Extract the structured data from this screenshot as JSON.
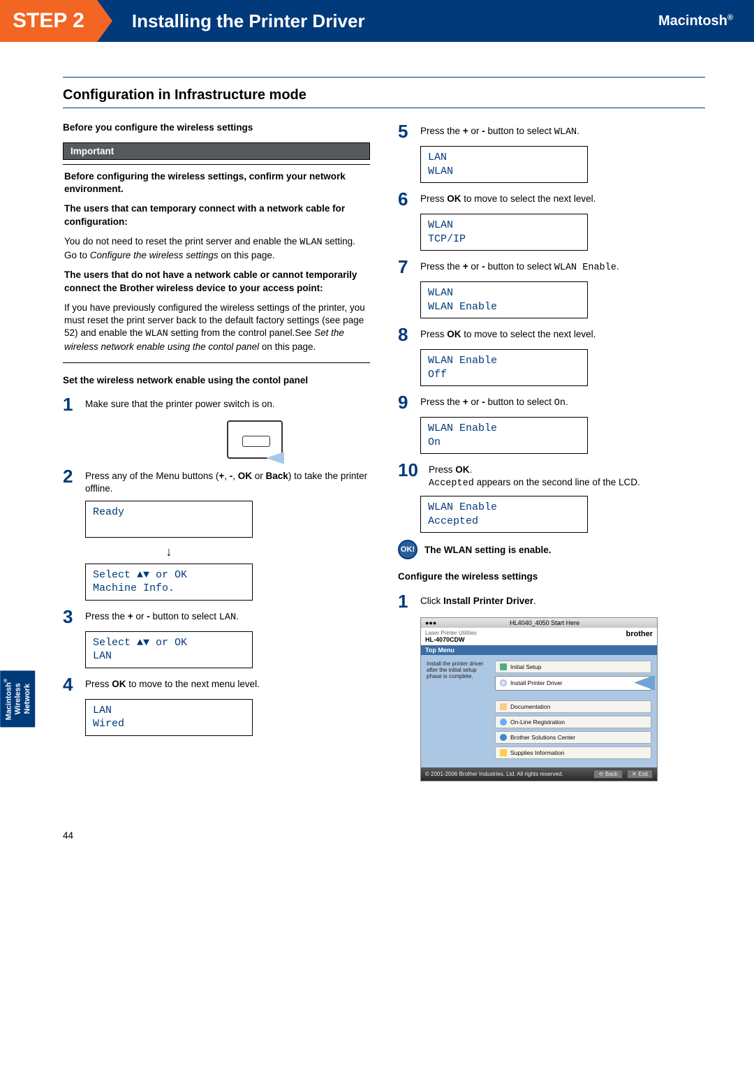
{
  "header": {
    "step_label": "STEP 2",
    "title": "Installing the Printer Driver",
    "platform": "Macintosh",
    "platform_sup": "®"
  },
  "section_title": "Configuration in Infrastructure mode",
  "left": {
    "before_head": "Before you configure the wireless settings",
    "important_label": "Important",
    "imp_p1": "Before configuring the wireless settings, confirm your  network environment.",
    "imp_p2": "The users that can temporary connect with a network cable for configuration:",
    "imp_p3a": "You do not need to reset the print server and enable the ",
    "imp_p3b": "WLAN",
    "imp_p3c": "  setting. Go to ",
    "imp_p3d": "Configure the wireless settings",
    "imp_p3e": " on this page.",
    "imp_p4": "The users that do not have a network cable or cannot temporarily connect the Brother wireless device to your access point:",
    "imp_p5a": "If you have previously configured the wireless settings of the printer, you must reset the print server back to the default factory settings (see page 52) and enable the ",
    "imp_p5b": "WLAN",
    "imp_p5c": " setting from the control panel.See ",
    "imp_p5d": "Set the wireless network enable using the contol panel",
    "imp_p5e": " on this page.",
    "set_head": "Set the wireless network enable using the contol panel",
    "s1_text": "Make sure that the printer power switch is on.",
    "s2_a": "Press any of the Menu buttons (",
    "s2_b": "+",
    "s2_c": ", ",
    "s2_d": "-",
    "s2_e": ", ",
    "s2_f": "OK",
    "s2_g": " or ",
    "s2_h": "Back",
    "s2_i": ") to take the printer offline.",
    "lcd_ready": "Ready",
    "lcd_select1_l1": "Select ▲▼ or OK",
    "lcd_select1_l2": "Machine Info.",
    "s3_a": "Press the ",
    "s3_b": "+",
    "s3_c": " or ",
    "s3_d": "-",
    "s3_e": " button to select ",
    "s3_f": "LAN",
    "s3_g": ".",
    "lcd_select2_l1": "Select ▲▼ or OK",
    "lcd_select2_l2": "LAN",
    "s4_a": "Press ",
    "s4_b": "OK",
    "s4_c": " to move to the next menu level.",
    "lcd_lan_l1": "LAN",
    "lcd_lan_l2": "Wired"
  },
  "right": {
    "s5_a": "Press the ",
    "s5_b": "+",
    "s5_c": " or ",
    "s5_d": "-",
    "s5_e": " button to select ",
    "s5_f": "WLAN",
    "s5_g": ".",
    "lcd5_l1": "LAN",
    "lcd5_l2": "WLAN",
    "s6_a": "Press ",
    "s6_b": "OK",
    "s6_c": " to move to select the next level.",
    "lcd6_l1": "WLAN",
    "lcd6_l2": "TCP/IP",
    "s7_a": "Press the ",
    "s7_b": "+",
    "s7_c": " or ",
    "s7_d": "-",
    "s7_e": " button to select ",
    "s7_f": "WLAN Enable",
    "s7_g": ".",
    "lcd7_l1": "WLAN",
    "lcd7_l2": "WLAN Enable",
    "s8_a": "Press ",
    "s8_b": "OK",
    "s8_c": " to move to select the next level.",
    "lcd8_l1": "WLAN Enable",
    "lcd8_l2": "Off",
    "s9_a": "Press the ",
    "s9_b": "+",
    "s9_c": " or ",
    "s9_d": "-",
    "s9_e": " button to select ",
    "s9_f": "On",
    "s9_g": ".",
    "lcd9_l1": "WLAN Enable",
    "lcd9_l2": "On",
    "s10_a": "Press ",
    "s10_b": "OK",
    "s10_c": ".",
    "s10_d": "Accepted",
    "s10_e": " appears on the second line of the LCD.",
    "lcd10_l1": "WLAN Enable",
    "lcd10_l2": "Accepted",
    "ok_badge": "OK!",
    "ok_text": "The WLAN setting is enable.",
    "conf_head": "Configure the wireless settings",
    "c1_a": "Click ",
    "c1_b": "Install Printer Driver",
    "c1_c": ".",
    "ss": {
      "titlebar_left": "Laser Printer Utilities",
      "titlebar_center": "HL4040_4050 Start Here",
      "head_left": "HL-4070CDW",
      "brand": "brother",
      "topmenu": "Top Menu",
      "left_text": "Install the printer driver after the initial setup phase is complete.",
      "item1": "Initial Setup",
      "item2": "Install Printer Driver",
      "item3": "Documentation",
      "item4": "On-Line Registration",
      "item5": "Brother Solutions Center",
      "item6": "Supplies Information",
      "footer_text": "© 2001-2006 Brother Industries, Ltd. All rights reserved.",
      "btn_back": "Back",
      "btn_exit": "Exit"
    }
  },
  "sidebar": "Macintosh® Wireless Network",
  "page_number": "44"
}
